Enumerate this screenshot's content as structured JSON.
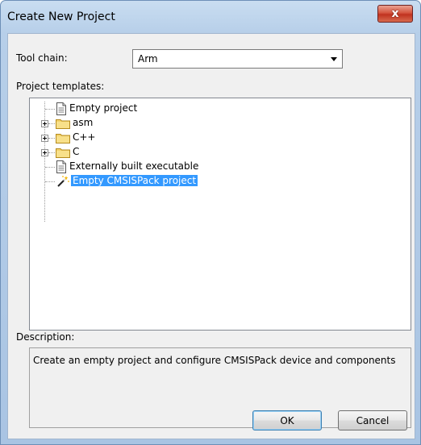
{
  "window": {
    "title": "Create New Project",
    "close_glyph": "x"
  },
  "toolchain": {
    "label": "Tool chain:",
    "selected": "Arm"
  },
  "templates": {
    "label": "Project templates:",
    "items": [
      {
        "label": "Empty project",
        "icon": "document-icon",
        "expandable": false,
        "selected": false
      },
      {
        "label": "asm",
        "icon": "folder-icon",
        "expandable": true,
        "selected": false
      },
      {
        "label": "C++",
        "icon": "folder-icon",
        "expandable": true,
        "selected": false
      },
      {
        "label": "C",
        "icon": "folder-icon",
        "expandable": true,
        "selected": false
      },
      {
        "label": "Externally built executable",
        "icon": "document-icon",
        "expandable": false,
        "selected": false
      },
      {
        "label": "Empty CMSISPack project",
        "icon": "magic-wand-icon",
        "expandable": false,
        "selected": true
      }
    ]
  },
  "description": {
    "label": "Description:",
    "text": "Create an empty project and configure CMSISPack device and components"
  },
  "buttons": {
    "ok": "OK",
    "cancel": "Cancel"
  }
}
